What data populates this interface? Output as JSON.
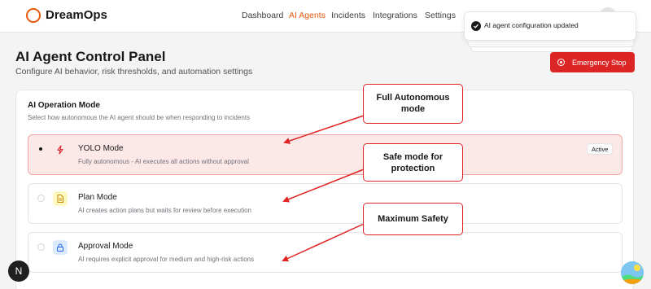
{
  "app": {
    "name": "DreamOps",
    "logo_color": "#ea580c"
  },
  "nav": [
    {
      "label": "Dashboard",
      "active": false
    },
    {
      "label": "AI Agents",
      "active": true
    },
    {
      "label": "Incidents",
      "active": false
    },
    {
      "label": "Integrations",
      "active": false
    },
    {
      "label": "Settings",
      "active": false
    }
  ],
  "toast": {
    "message": "AI agent configuration updated",
    "icon": "check-circle-icon"
  },
  "page": {
    "title": "AI Agent Control Panel",
    "subtitle": "Configure AI behavior, risk thresholds, and automation settings",
    "emergency_button": "Emergency Stop",
    "emergency_color": "#dc2626"
  },
  "operation_mode": {
    "title": "AI Operation Mode",
    "subtitle": "Select how autonomous the AI agent should be when responding to incidents",
    "modes": [
      {
        "name": "YOLO Mode",
        "description": "Fully autonomous - AI executes all actions without approval",
        "icon": "lightning-bolt-icon",
        "selected": true,
        "badge": "Active"
      },
      {
        "name": "Plan Mode",
        "description": "AI creates action plans but waits for review before execution",
        "icon": "document-icon",
        "selected": false,
        "badge": ""
      },
      {
        "name": "Approval Mode",
        "description": "AI requires explicit approval for medium and high-risk actions",
        "icon": "lock-icon",
        "selected": false,
        "badge": ""
      }
    ]
  },
  "annotations": {
    "yolo": "Full Autonomous mode",
    "plan": "Safe mode for protection",
    "approval": "Maximum Safety"
  },
  "floating": {
    "next_label": "N"
  }
}
